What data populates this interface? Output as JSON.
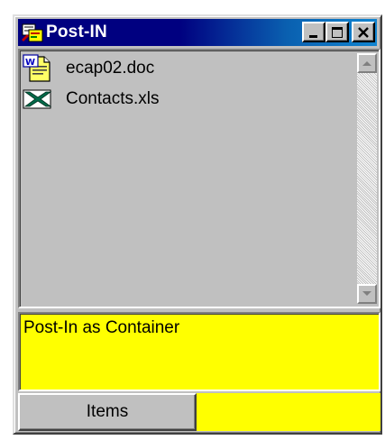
{
  "window": {
    "title": "Post-IN",
    "title_bar_gradient": [
      "#000080",
      "#1084d0"
    ],
    "title_buttons": [
      "minimize",
      "maximize",
      "close"
    ]
  },
  "files": [
    {
      "name": "ecap02.doc",
      "icon": "word-document-icon"
    },
    {
      "name": "Contacts.xls",
      "icon": "excel-spreadsheet-icon"
    }
  ],
  "note": {
    "text": "Post-In as Container",
    "background": "#ffff00"
  },
  "bottom": {
    "items_label": "Items"
  },
  "colors": {
    "face": "#c0c0c0",
    "note": "#ffff00"
  }
}
